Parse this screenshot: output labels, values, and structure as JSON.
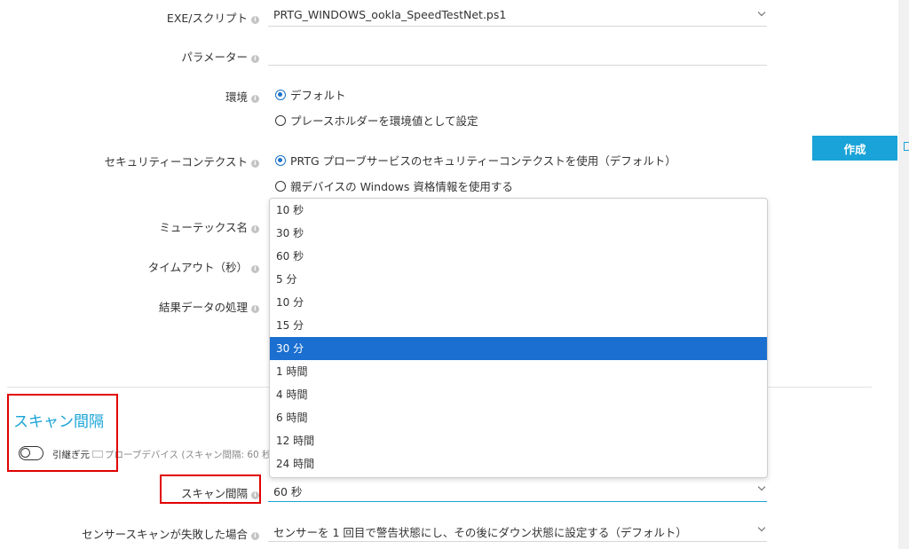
{
  "fields": {
    "exe_label": "EXE/スクリプト",
    "exe_value": "PRTG_WINDOWS_ookla_SpeedTestNet.ps1",
    "param_label": "パラメーター",
    "param_value": "",
    "env_label": "環境",
    "env_options": [
      "デフォルト",
      "プレースホルダーを環境値として設定"
    ],
    "security_label": "セキュリティーコンテクスト",
    "security_options": [
      "PRTG プローブサービスのセキュリティーコンテクストを使用（デフォルト）",
      "親デバイスの Windows 資格情報を使用する"
    ],
    "mutex_label": "ミューテックス名",
    "timeout_label": "タイムアウト（秒）",
    "result_label": "結果データの処理"
  },
  "create_button": "作成",
  "dropdown": {
    "options": [
      "10 秒",
      "30 秒",
      "60 秒",
      "5 分",
      "10 分",
      "15 分",
      "30 分",
      "1 時間",
      "4 時間",
      "6 時間",
      "12 時間",
      "24 時間"
    ],
    "highlighted": "30 分"
  },
  "scan": {
    "section_title": "スキャン間隔",
    "inherit_label": "引継ぎ元",
    "inherit_source": "プローブデバイス (スキャン間隔: 60 秒",
    "interval_label": "スキャン間隔",
    "interval_value": "60 秒",
    "fail_label": "センサースキャンが失敗した場合",
    "fail_value": "センサーを 1 回目で警告状態にし、その後にダウン状態に設定する（デフォルト）"
  }
}
